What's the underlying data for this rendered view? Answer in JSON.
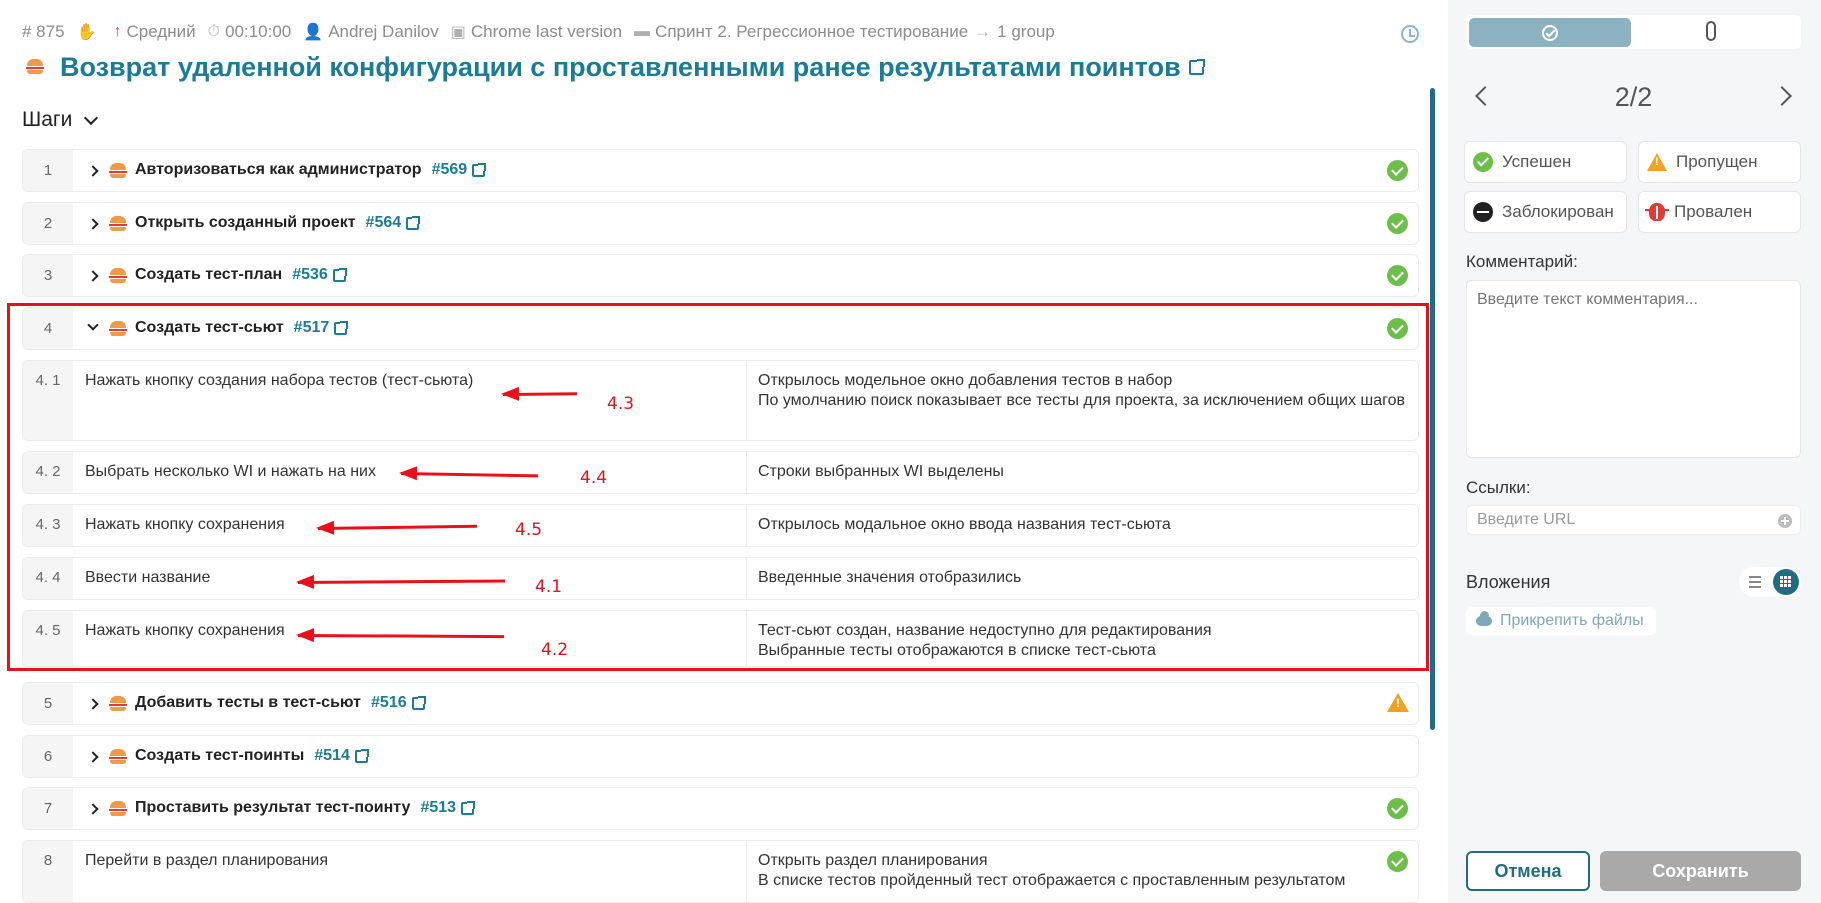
{
  "header": {
    "meta": [
      {
        "icon": "hash-icon",
        "text": "# 875"
      },
      {
        "icon": "arrow-up-icon",
        "text": "Средний"
      },
      {
        "icon": "timer-icon",
        "text": "00:10:00"
      },
      {
        "icon": "user-icon",
        "text": "Andrej Danilov"
      },
      {
        "icon": "environment-icon",
        "text": "Chrome last version"
      },
      {
        "icon": "folder-icon",
        "text": "Спринт 2. Регрессионное тестирование"
      },
      {
        "icon": "arrow-right-icon",
        "text": "1 group"
      }
    ],
    "title": "Возврат удаленной конфигурации с проставленными ранее результатами поинтов"
  },
  "steps_heading": "Шаги",
  "steps": [
    {
      "num": "1",
      "title": "Авторизоваться как администратор",
      "link": "#569",
      "status": "passed"
    },
    {
      "num": "2",
      "title": "Открыть созданный проект",
      "link": "#564",
      "status": "passed"
    },
    {
      "num": "3",
      "title": "Создать тест-план",
      "link": "#536",
      "status": "passed"
    },
    {
      "num": "4",
      "title": "Создать тест-сьют",
      "link": "#517",
      "status": "passed"
    },
    {
      "num": "5",
      "title": "Добавить тесты в тест-сьют",
      "link": "#516",
      "status": "skipped"
    },
    {
      "num": "6",
      "title": "Создать тест-поинты",
      "link": "#514",
      "status": "none"
    },
    {
      "num": "7",
      "title": "Проставить результат тест-поинту",
      "link": "#513",
      "status": "passed"
    }
  ],
  "substeps": [
    {
      "num": "4. 1",
      "action": "Нажать кнопку создания набора тестов (тест-сьюта)",
      "result_lines": [
        "Открылось модельное окно добавления тестов в набор",
        "По умолчанию поиск показывает все тесты для проекта, за исключением общих шагов"
      ]
    },
    {
      "num": "4. 2",
      "action": "Выбрать несколько WI и нажать на них",
      "result_lines": [
        "Строки выбранных WI выделены"
      ]
    },
    {
      "num": "4. 3",
      "action": "Нажать кнопку сохранения",
      "result_lines": [
        "Открылось модальное окно ввода названия тест-сьюта"
      ]
    },
    {
      "num": "4. 4",
      "action": "Ввести название",
      "result_lines": [
        "Введенные значения отобразились"
      ]
    },
    {
      "num": "4. 5",
      "action": "Нажать кнопку сохранения",
      "result_lines": [
        "Тест-сьют создан, название недоступно для редактирования",
        "Выбранные тесты отображаются в списке тест-сьюта"
      ]
    }
  ],
  "step8": {
    "num": "8",
    "action": "Перейти в раздел планирования",
    "result_lines": [
      "Открыть раздел планирования",
      "В списке тестов пройденный тест отображается с проставленным результатом"
    ],
    "status": "passed"
  },
  "annotations": [
    "4.3",
    "4.4",
    "4.5",
    "4.1",
    "4.2"
  ],
  "annotation_color": "#e8101b",
  "panel": {
    "pager": "2/2",
    "statuses": [
      "Успешен",
      "Пропущен",
      "Заблокирован",
      "Провален"
    ],
    "comment_label": "Комментарий:",
    "comment_placeholder": "Введите текст комментария...",
    "links_label": "Ссылки:",
    "url_placeholder": "Введите URL",
    "attachments_label": "Вложения",
    "attach_button": "Прикрепить файлы",
    "cancel": "Отмена",
    "save": "Сохранить"
  },
  "colors": {
    "accent": "#1a7c96",
    "passed": "#6cc04a",
    "skipped": "#f2a122",
    "failed": "#e53935"
  }
}
